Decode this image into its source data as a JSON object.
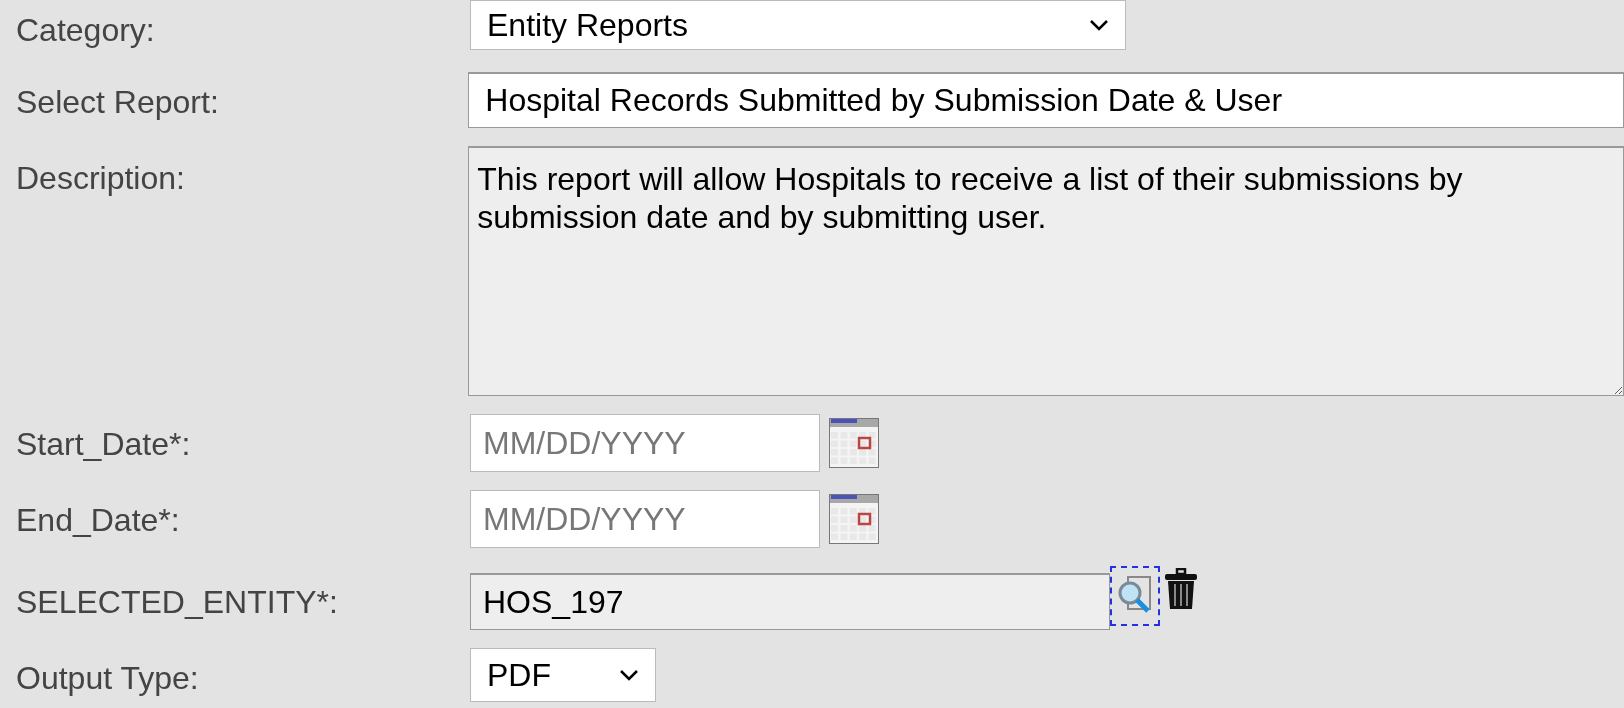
{
  "fields": [
    {
      "kind": "select",
      "label": "Category:",
      "value": "Entity Reports"
    },
    {
      "kind": "text",
      "label": "Select Report:",
      "value": "Hospital Records Submitted by Submission Date & User"
    },
    {
      "kind": "textarea",
      "label": "Description:",
      "value": "This report will allow Hospitals to receive a list of their submissions by submission date and by submitting user."
    },
    {
      "kind": "date",
      "label": "Start_Date*:",
      "placeholder": "MM/DD/YYYY"
    },
    {
      "kind": "date",
      "label": "End_Date*:",
      "placeholder": "MM/DD/YYYY"
    },
    {
      "kind": "lookup",
      "label": "SELECTED_ENTITY*:",
      "value": "HOS_197"
    },
    {
      "kind": "small-select",
      "label": "Output Type:",
      "value": "PDF"
    }
  ]
}
